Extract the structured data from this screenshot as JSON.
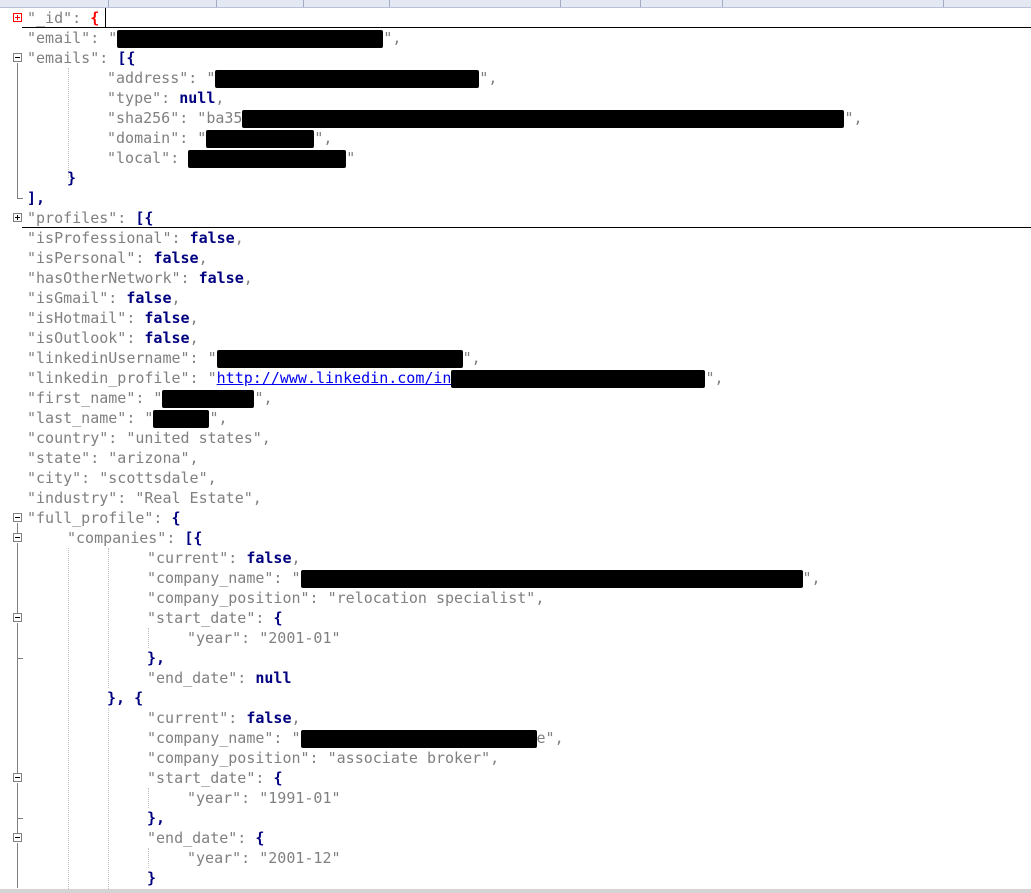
{
  "lines": {
    "l1_key": "\"_id\": ",
    "l1_brace": "{",
    "l2_key": "\"email\": \"",
    "l2_end": "\",",
    "l3_key": "\"emails\": ",
    "l3_brace": "[{",
    "l4_key": "\"address\": \"",
    "l4_end": "\",",
    "l5_key": "\"type\": ",
    "l5_val": "null",
    "l5_end": ",",
    "l6_key": "\"sha256\": \"ba35",
    "l6_end": "\",",
    "l7_key": "\"domain\": \"",
    "l7_end": "\",",
    "l8_key": "\"local\": ",
    "l8_end": "\"",
    "l9": "}",
    "l10": "],",
    "l11_key": "\"profiles\": ",
    "l11_brace": "[{",
    "l12_key": "\"isProfessional\": ",
    "l12_val": "false",
    "l13_key": "\"isPersonal\": ",
    "l13_val": "false",
    "l14_key": "\"hasOtherNetwork\": ",
    "l14_val": "false",
    "l15_key": "\"isGmail\": ",
    "l15_val": "false",
    "l16_key": "\"isHotmail\": ",
    "l16_val": "false",
    "l17_key": "\"isOutlook\": ",
    "l17_val": "false",
    "comma": ",",
    "l18_key": "\"linkedinUsername\": \"",
    "l18_end": "\",",
    "l19_key": "\"linkedin_profile\": \"",
    "l19_link": "http://www.linkedin.com/in",
    "l19_end": "\",",
    "l20_key": "\"first_name\": \"",
    "l20_end": "\",",
    "l21_key": "\"last_name\": \"",
    "l21_end": "\",",
    "l22": "\"country\": \"united states\",",
    "l23": "\"state\": \"arizona\",",
    "l24": "\"city\": \"scottsdale\",",
    "l25": "\"industry\": \"Real Estate\",",
    "l26_key": "\"full_profile\": ",
    "l26_brace": "{",
    "l27_key": "\"companies\": ",
    "l27_brace": "[{",
    "l28_key": "\"current\": ",
    "l28_val": "false",
    "l29_key": "\"company_name\": \"",
    "l29_end": "\",",
    "l30": "\"company_position\": \"relocation specialist\",",
    "l31_key": "\"start_date\": ",
    "l31_brace": "{",
    "l32": "\"year\": \"2001-01\"",
    "l33": "},",
    "l34_key": "\"end_date\": ",
    "l34_val": "null",
    "l35": "}, {",
    "l36_key": "\"current\": ",
    "l36_val": "false",
    "l37_key": "\"company_name\": \"",
    "l37_end": "e\",",
    "l38": "\"company_position\": \"associate broker\",",
    "l39_key": "\"start_date\": ",
    "l39_brace": "{",
    "l40": "\"year\": \"1991-01\"",
    "l41": "},",
    "l42_key": "\"end_date\": ",
    "l42_brace": "{",
    "l43": "\"year\": \"2001-12\"",
    "l44": "}"
  }
}
